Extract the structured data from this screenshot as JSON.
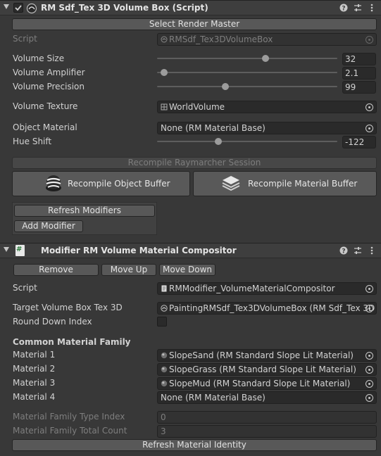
{
  "component1": {
    "title": "RM Sdf_Tex 3D Volume Box (Script)",
    "icons": [
      "question-icon",
      "sliders-icon",
      "kebab-icon"
    ],
    "select_render_master": "Select Render Master",
    "script_label": "Script",
    "script_value": "RMSdf_Tex3DVolumeBox",
    "volume_size_label": "Volume Size",
    "volume_size_value": "32",
    "volume_size_fraction": 0.6,
    "volume_amplifier_label": "Volume Amplifier",
    "volume_amplifier_value": "2.1",
    "volume_amplifier_fraction": 0.04,
    "volume_precision_label": "Volume Precision",
    "volume_precision_value": "99",
    "volume_precision_fraction": 0.38,
    "volume_texture_label": "Volume Texture",
    "volume_texture_value": "WorldVolume",
    "object_material_label": "Object Material",
    "object_material_value": "None (RM Material Base)",
    "hue_shift_label": "Hue Shift",
    "hue_shift_value": "-122",
    "hue_shift_fraction": 0.34,
    "recompile_session": "Recompile Raymarcher Session",
    "recompile_object_buffer": "Recompile Object Buffer",
    "recompile_material_buffer": "Recompile Material Buffer",
    "refresh_modifiers": "Refresh Modifiers",
    "add_modifier": "Add Modifier"
  },
  "component2": {
    "title": "Modifier RM Volume Material Compositor",
    "icons": [
      "question-icon",
      "sliders-icon",
      "kebab-icon"
    ],
    "remove": "Remove",
    "move_up": "Move Up",
    "move_down": "Move Down",
    "script_label": "Script",
    "script_value": "RMModifier_VolumeMaterialCompositor",
    "target_label": "Target Volume Box Tex 3D",
    "target_value": "PaintingRMSdf_Tex3DVolumeBox (RM Sdf_Tex 3D",
    "round_down_label": "Round Down Index",
    "round_down_checked": false,
    "family_header": "Common Material Family",
    "materials": [
      {
        "label": "Material 1",
        "value": "SlopeSand (RM Standard Slope Lit Material)"
      },
      {
        "label": "Material 2",
        "value": "SlopeGrass (RM Standard Slope Lit Material)"
      },
      {
        "label": "Material 3",
        "value": "SlopeMud (RM Standard Slope Lit Material)"
      },
      {
        "label": "Material 4",
        "value": "None (RM Material Base)"
      }
    ],
    "family_type_index_label": "Material Family Type Index",
    "family_type_index_value": "0",
    "family_total_count_label": "Material Family Total Count",
    "family_total_count_value": "3",
    "refresh_identity": "Refresh Material Identity"
  }
}
